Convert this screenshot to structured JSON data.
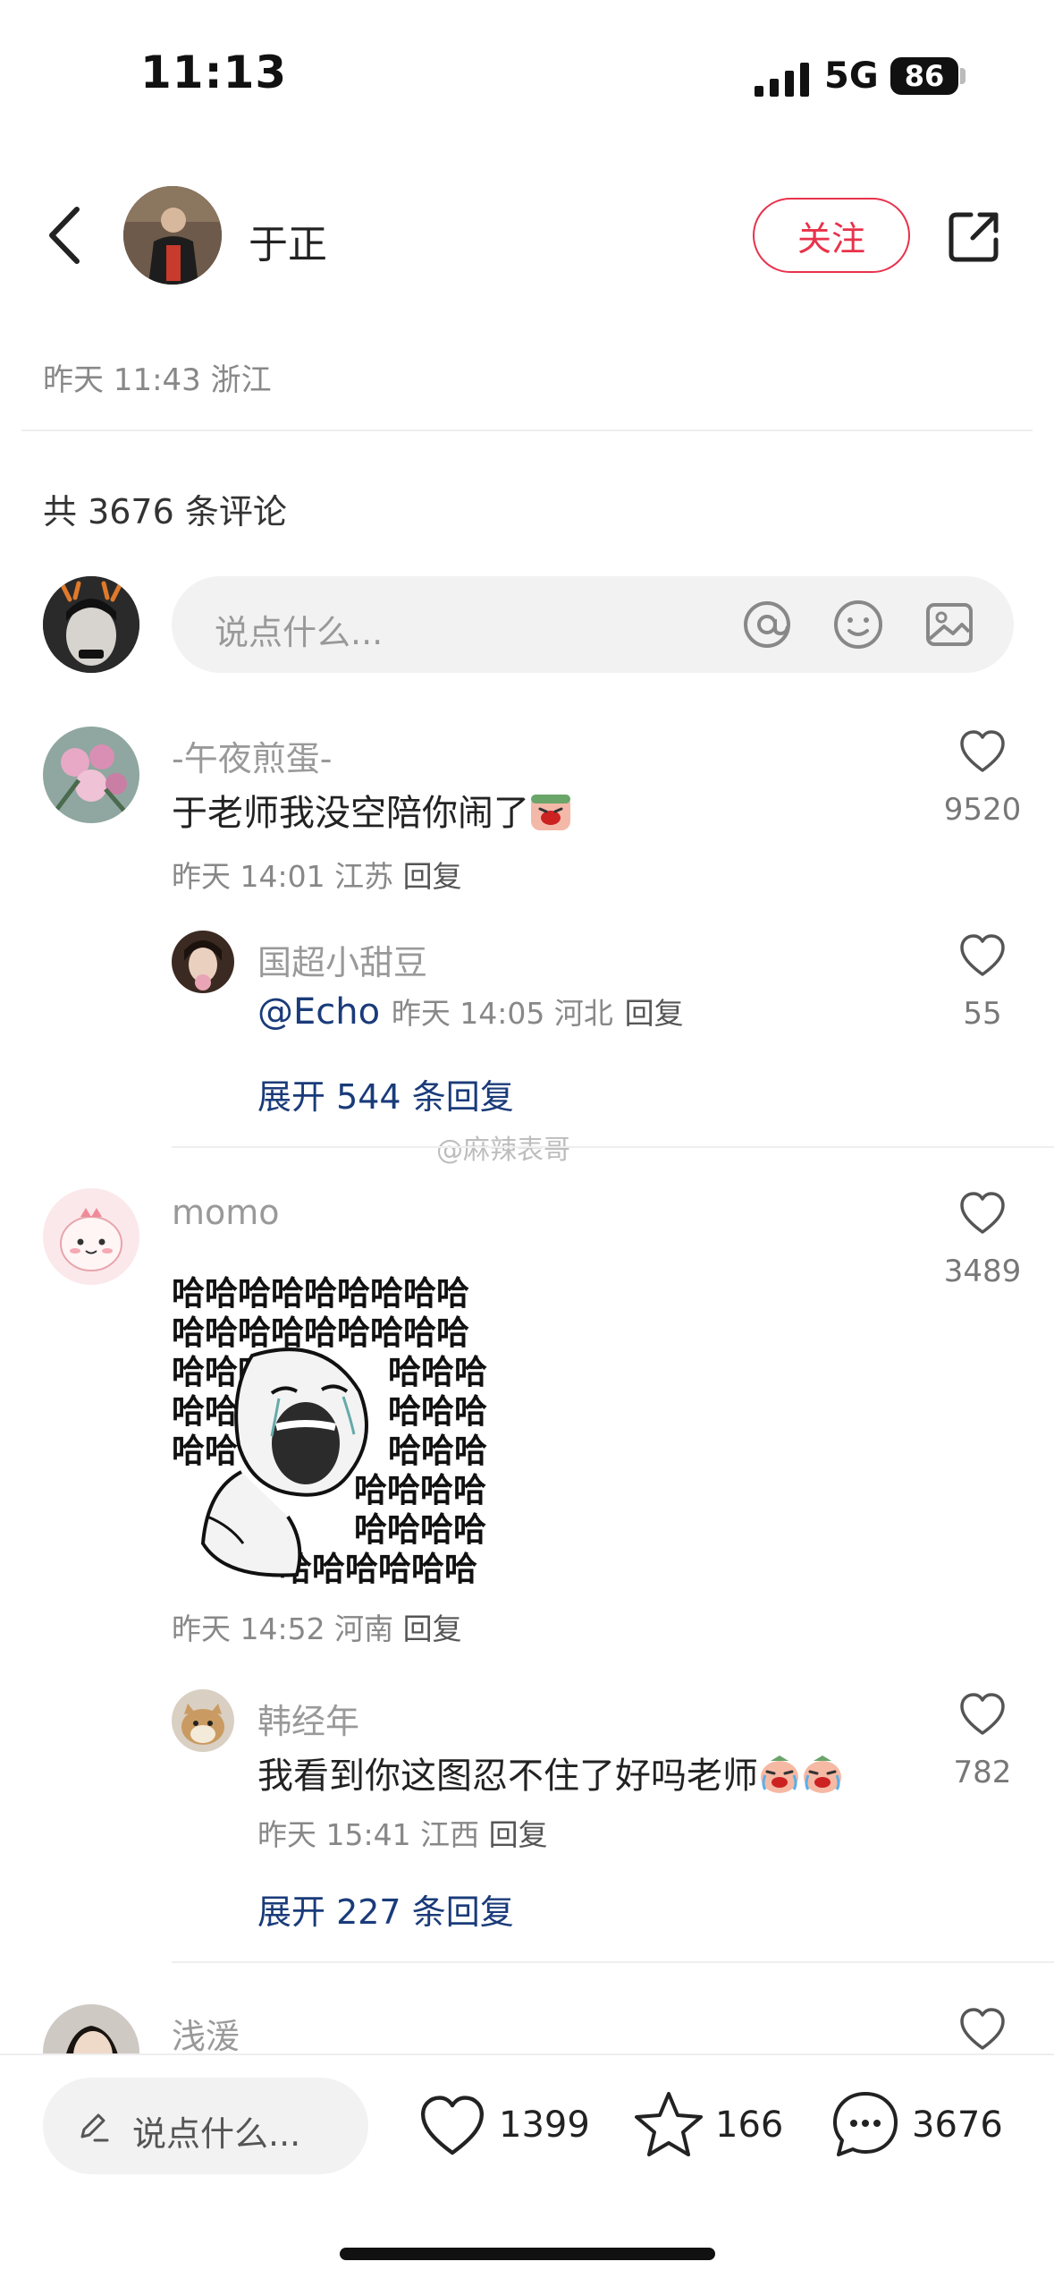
{
  "status_bar": {
    "time": "11:13",
    "network": "5G",
    "battery": "86"
  },
  "header": {
    "author_name": "于正",
    "follow_label": "关注",
    "post_meta": "昨天 11:43 浙江"
  },
  "comments_header": {
    "total_label": "共 3676 条评论"
  },
  "input": {
    "placeholder": "说点什么..."
  },
  "comments": [
    {
      "name": "-午夜煎蛋-",
      "text": "于老师我没空陪你闹了",
      "meta": "昨天 14:01 江苏",
      "reply_label": "回复",
      "likes": "9520",
      "replies": [
        {
          "name": "国超小甜豆",
          "mention": "@Echo",
          "meta": "昨天 14:05 河北",
          "reply_label": "回复",
          "likes": "55"
        }
      ],
      "expand_label": "展开 544 条回复"
    },
    {
      "name": "momo",
      "meme_lines": [
        "哈哈哈哈哈哈哈哈哈",
        "哈哈哈哈哈哈哈哈哈",
        "哈哈哈",
        "哈哈",
        "哈哈"
      ],
      "meme_right_lines": [
        "哈哈哈",
        "哈哈哈",
        "哈哈哈",
        "哈哈哈哈",
        "哈哈哈哈",
        "哈哈哈哈哈哈"
      ],
      "meta": "昨天 14:52 河南",
      "reply_label": "回复",
      "likes": "3489",
      "replies": [
        {
          "name": "韩经年",
          "text": "我看到你这图忍不住了好吗老师",
          "meta": "昨天 15:41 江西",
          "reply_label": "回复",
          "likes": "782"
        }
      ],
      "expand_label": "展开 227 条回复"
    },
    {
      "name": "浅湲"
    }
  ],
  "watermark": "@麻辣表哥",
  "bottom_bar": {
    "placeholder": "说点什么...",
    "likes": "1399",
    "favorites": "166",
    "comments": "3676"
  },
  "icons": [
    "back-icon",
    "share-icon",
    "at-icon",
    "emoji-icon",
    "image-icon",
    "heart-icon",
    "star-icon",
    "comment-icon",
    "pencil-icon"
  ],
  "colors": {
    "accent_red": "#e8324b",
    "link_blue": "#1a3b7a",
    "muted": "#999999"
  }
}
